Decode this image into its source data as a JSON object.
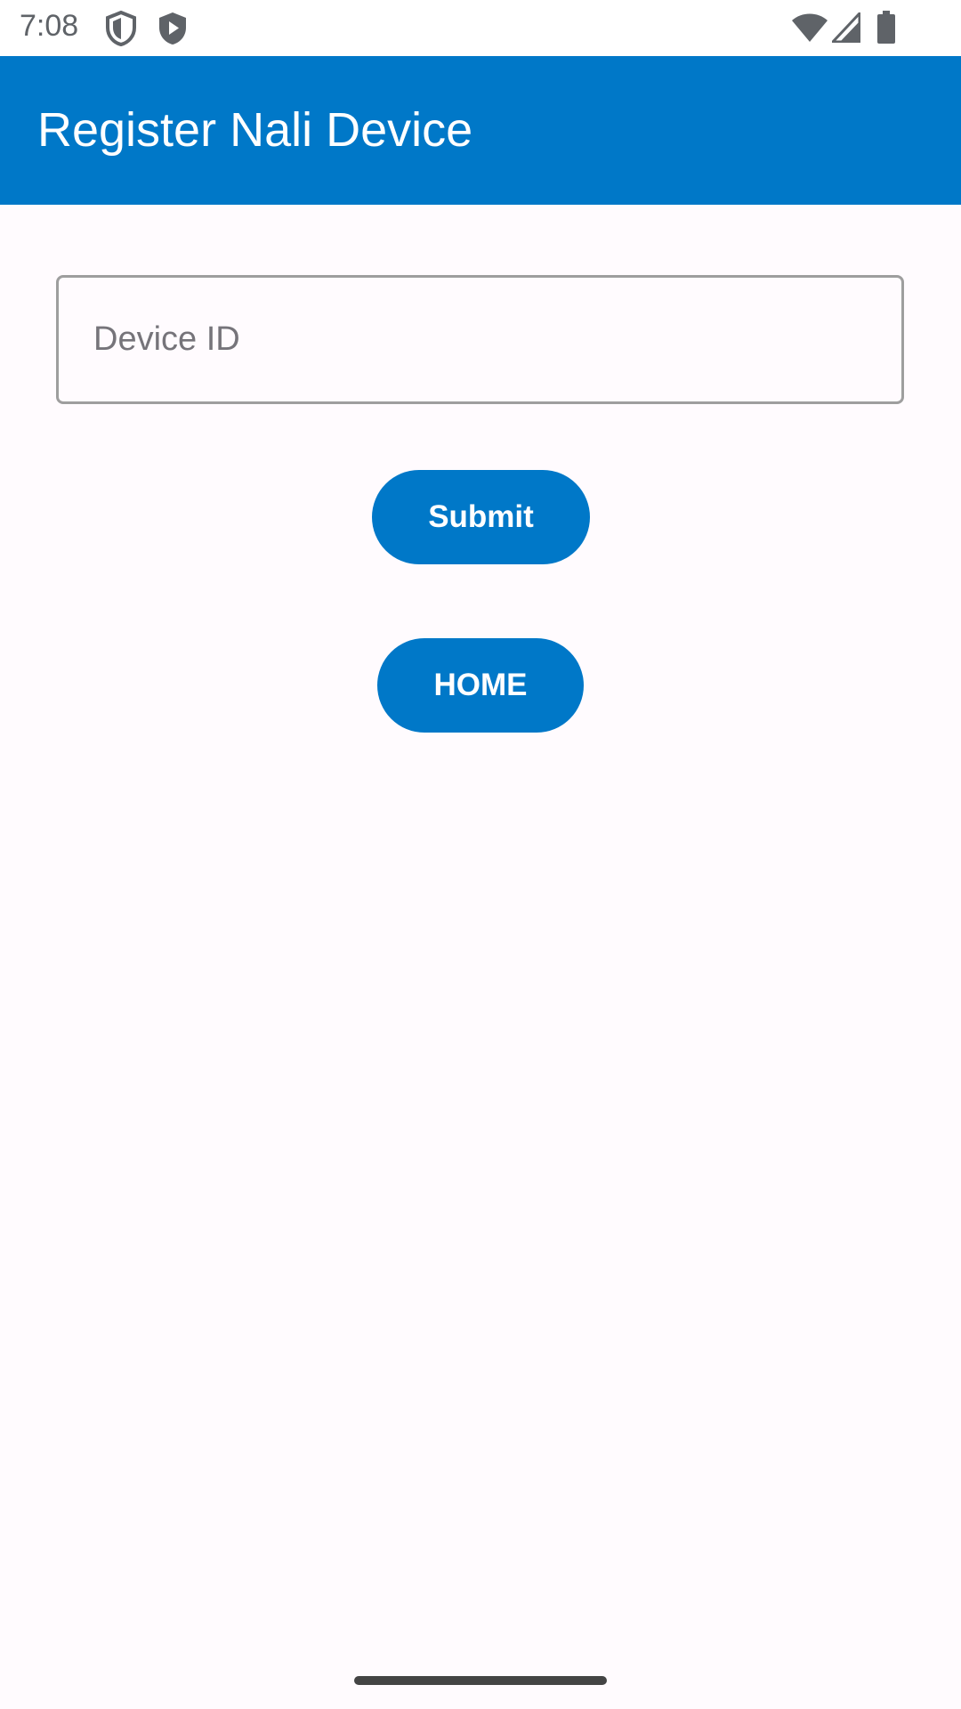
{
  "status_bar": {
    "time": "7:08",
    "icons": [
      "shield-outline-icon",
      "shield-play-icon",
      "wifi-icon",
      "signal-icon",
      "battery-icon"
    ]
  },
  "app_bar": {
    "title": "Register Nali Device",
    "color": "#0078c8"
  },
  "form": {
    "device_id": {
      "value": "",
      "placeholder": "Device ID"
    },
    "submit_label": "Submit",
    "home_label": "HOME"
  },
  "colors": {
    "accent": "#0078c8",
    "background": "#fffbfe",
    "field_border": "#9e9e9e"
  }
}
